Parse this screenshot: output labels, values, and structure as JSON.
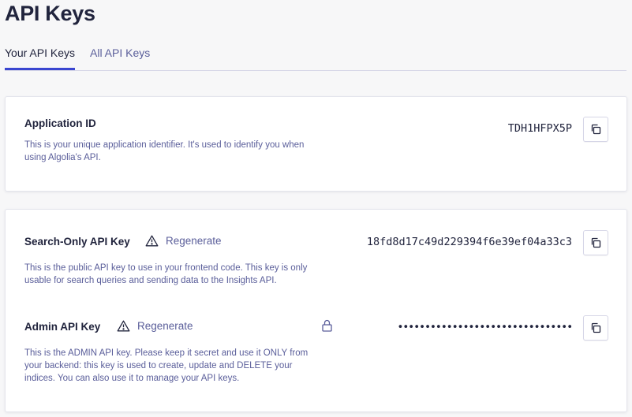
{
  "page": {
    "title": "API Keys"
  },
  "tabs": [
    {
      "label": "Your API Keys",
      "active": true
    },
    {
      "label": "All API Keys",
      "active": false
    }
  ],
  "application": {
    "label": "Application ID",
    "description": "This is your unique application identifier. It's used to identify you when using Algolia's API.",
    "value": "TDH1HFPX5P",
    "copy_icon": "copy-icon"
  },
  "search_key": {
    "label": "Search-Only API Key",
    "regenerate_label": "Regenerate",
    "description": "This is the public API key to use in your frontend code. This key is only usable for search queries and sending data to the Insights API.",
    "value": "18fd8d17c49d229394f6e39ef04a33c3",
    "copy_icon": "copy-icon"
  },
  "admin_key": {
    "label": "Admin API Key",
    "regenerate_label": "Regenerate",
    "description": "This is the ADMIN API key. Please keep it secret and use it ONLY from your backend: this key is used to create, update and DELETE your indices. You can also use it to manage your API keys.",
    "value": "••••••••••••••••••••••••••••••••",
    "lock_icon": "lock-icon",
    "copy_icon": "copy-icon"
  },
  "colors": {
    "accent": "#3a46d0",
    "text": "#21243d",
    "muted": "#5a5e9a"
  }
}
